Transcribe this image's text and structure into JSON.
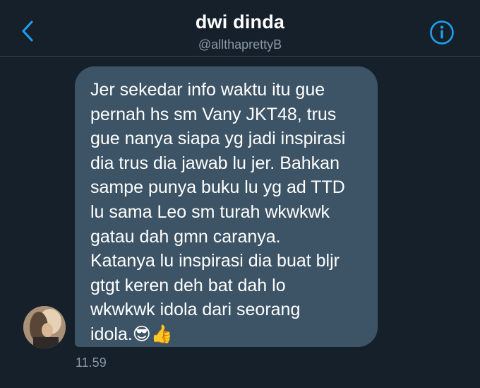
{
  "header": {
    "title": "dwi dinda",
    "handle": "@allthaprettyB",
    "back_icon": "chevron-left-icon",
    "info_icon": "info-icon",
    "accent_color": "#1da1f2"
  },
  "conversation": {
    "messages": [
      {
        "text": "Jer sekedar info waktu itu gue\npernah hs sm Vany JKT48, trus\ngue nanya siapa yg jadi inspirasi\ndia trus dia jawab lu jer. Bahkan\nsampe punya buku lu yg ad TTD\nlu sama Leo sm turah wkwkwk\ngatau dah gmn caranya.\nKatanya lu inspirasi dia buat bljr\ngtgt keren deh bat dah lo\nwkwkwk idola dari seorang\nidola.😎👍",
        "timestamp": "11.59"
      }
    ]
  }
}
